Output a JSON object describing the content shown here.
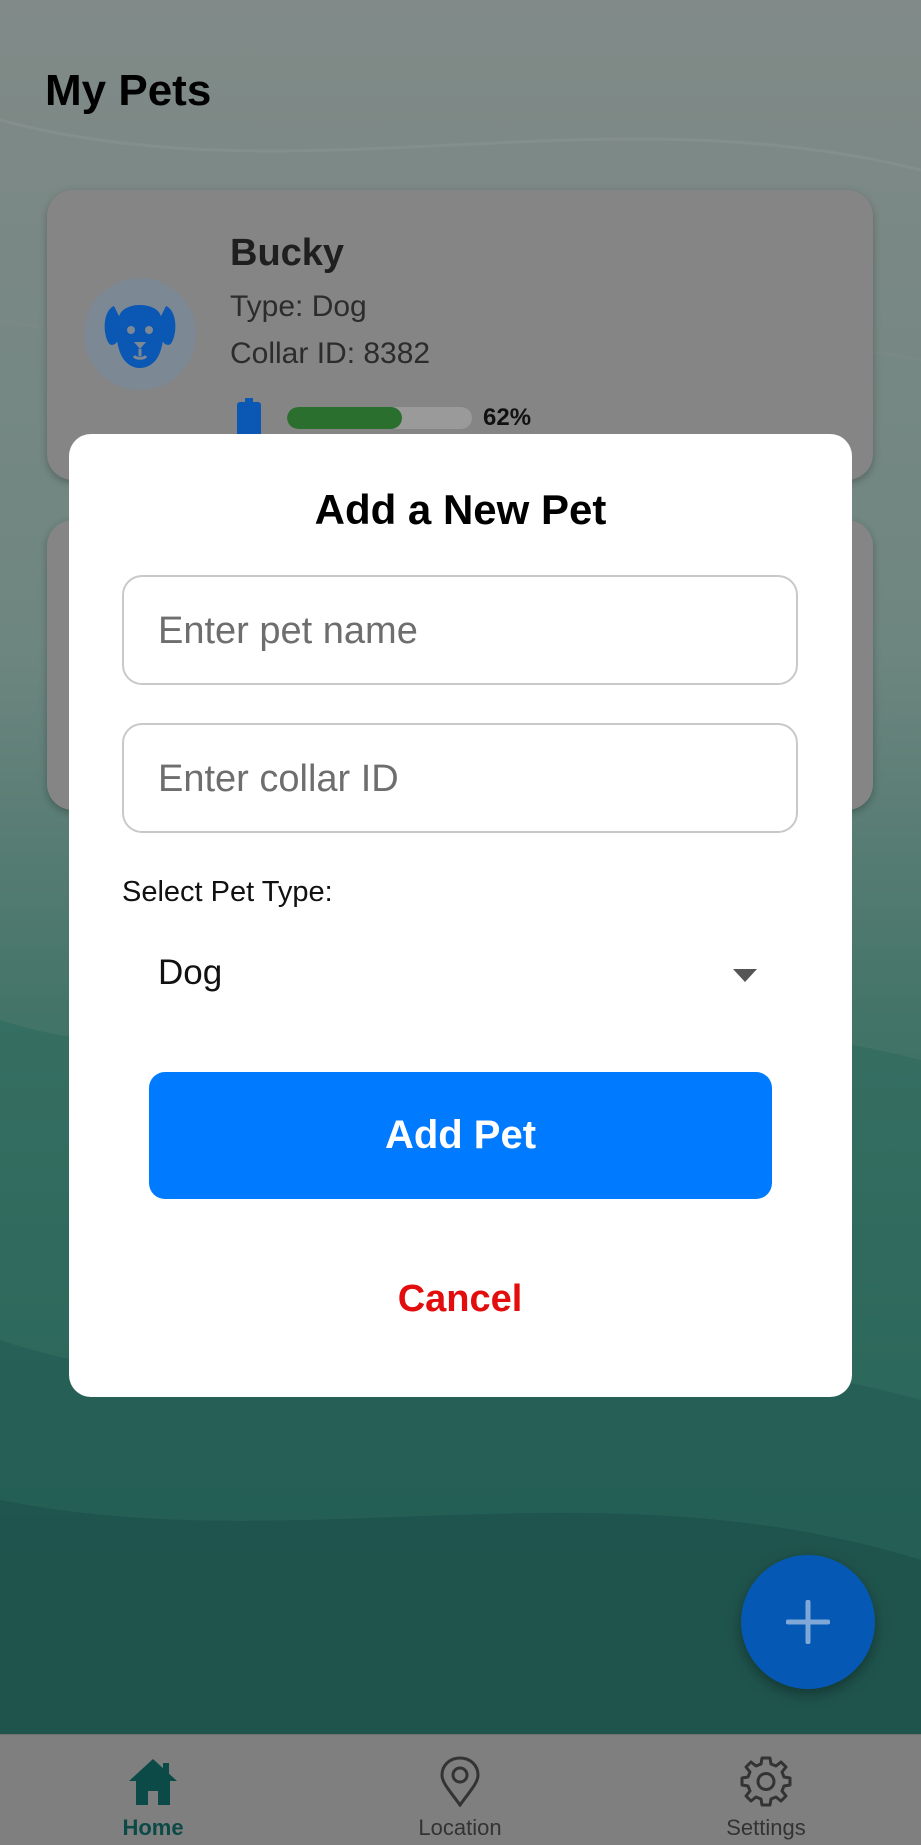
{
  "page": {
    "title": "My Pets"
  },
  "pets": [
    {
      "name": "Bucky",
      "type_text": "Type: Dog",
      "collar_text": "Collar ID: 8382",
      "battery_percent": 62,
      "battery_label": "62%",
      "icon": "dog-icon"
    }
  ],
  "fab": {
    "icon": "plus-icon"
  },
  "bottom_nav": {
    "items": [
      {
        "label": "Home",
        "icon": "home-icon",
        "active": true
      },
      {
        "label": "Location",
        "icon": "location-pin-icon",
        "active": false
      },
      {
        "label": "Settings",
        "icon": "gear-icon",
        "active": false
      }
    ]
  },
  "modal": {
    "title": "Add a New Pet",
    "name_field": {
      "placeholder": "Enter pet name",
      "value": ""
    },
    "collar_field": {
      "placeholder": "Enter collar ID",
      "value": ""
    },
    "select_label": "Select Pet Type:",
    "select_value": "Dog",
    "add_button_label": "Add Pet",
    "cancel_button_label": "Cancel"
  },
  "colors": {
    "primary_button": "#007bff",
    "cancel_text": "#e30d0d",
    "battery_fill": "#2b6f2e",
    "fab": "#0559b5",
    "active_nav": "#0c4a47"
  }
}
